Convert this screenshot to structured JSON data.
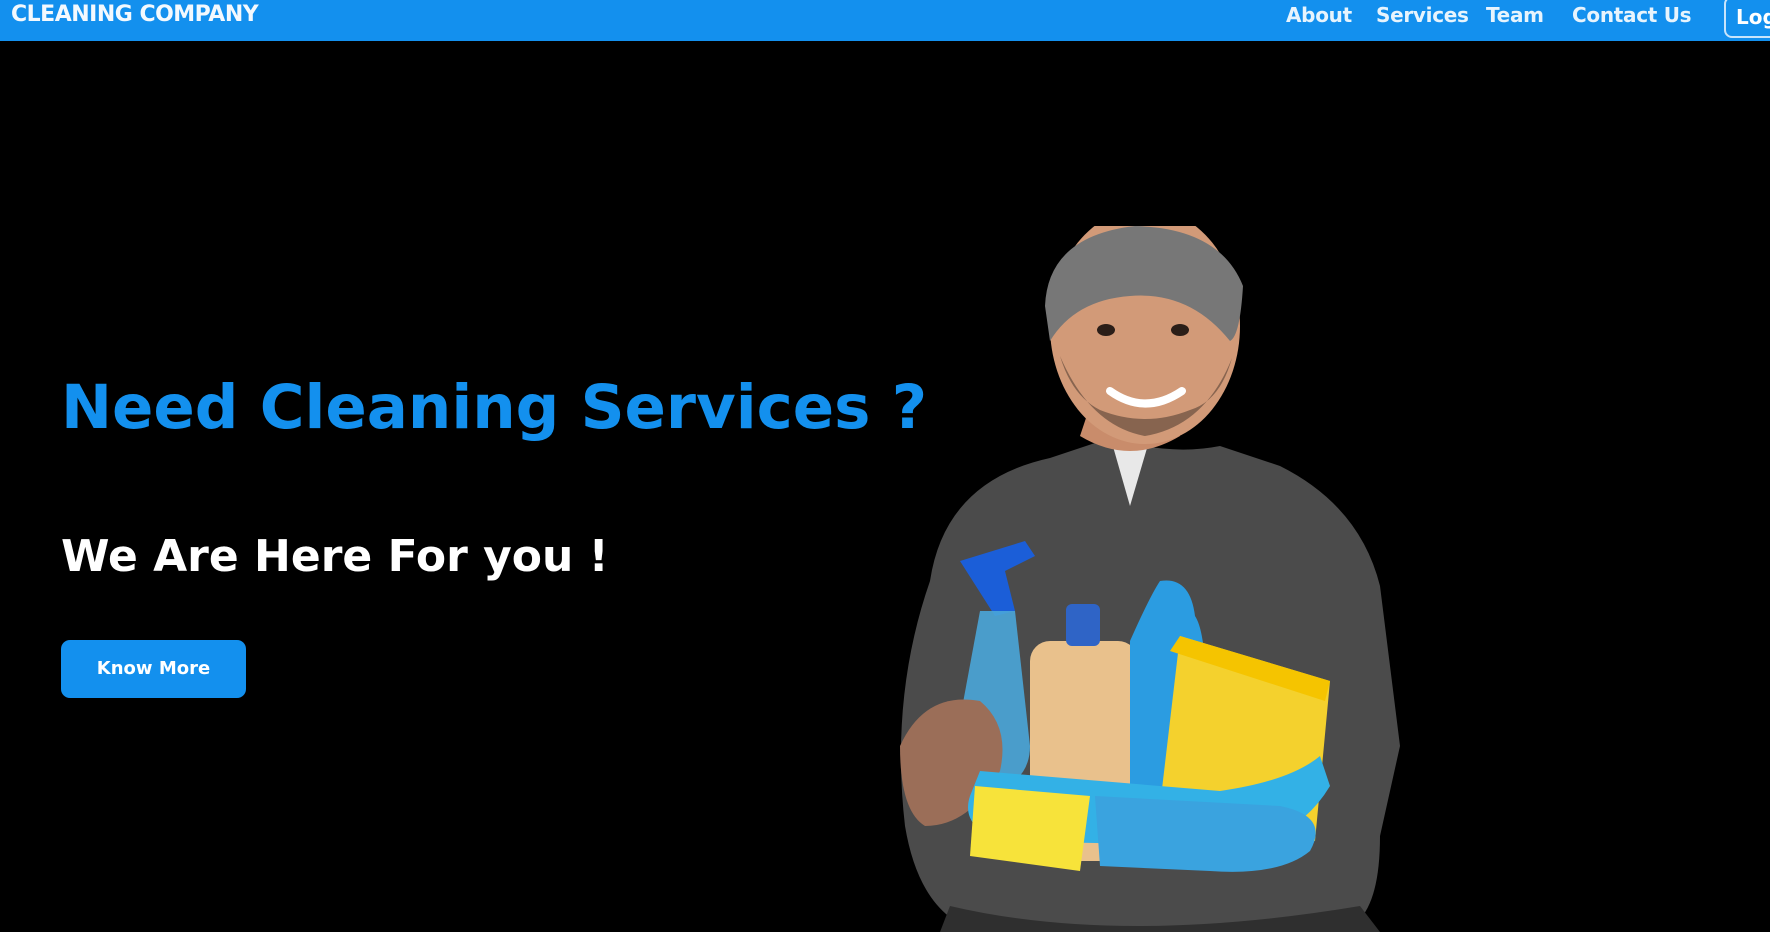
{
  "header": {
    "brand": "CLEANING COMPANY",
    "nav": [
      "About",
      "Services",
      "Team",
      "Contact Us"
    ],
    "login_label": "Log"
  },
  "hero": {
    "headline": "Need Cleaning Services ?",
    "subheadline": "We Are Here For you !",
    "cta_label": "Know More",
    "image_alt": "Smiling cleaner holding cleaning supplies and gloves"
  },
  "colors": {
    "accent": "#1390ee",
    "background": "#000000",
    "text_light": "#ffffff"
  }
}
